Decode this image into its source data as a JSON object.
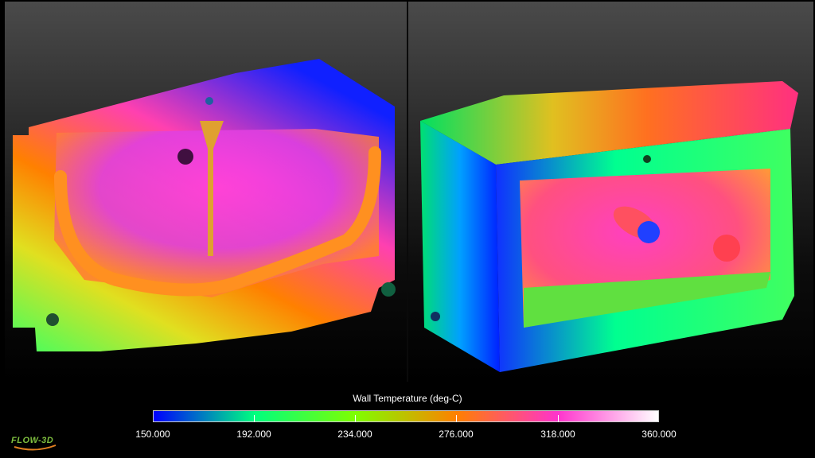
{
  "legend": {
    "title": "Wall Temperature (deg-C)",
    "ticks": [
      "150.000",
      "192.000",
      "234.000",
      "276.000",
      "318.000",
      "360.000"
    ],
    "colors": [
      "#0000ff",
      "#00ff7f",
      "#7fff00",
      "#ff8000",
      "#ff33cc",
      "#ffffff"
    ]
  },
  "logo": {
    "text": "FLOW-3D"
  },
  "views": [
    {
      "name": "mold-half-cavity-view"
    },
    {
      "name": "mold-half-exterior-view"
    }
  ]
}
